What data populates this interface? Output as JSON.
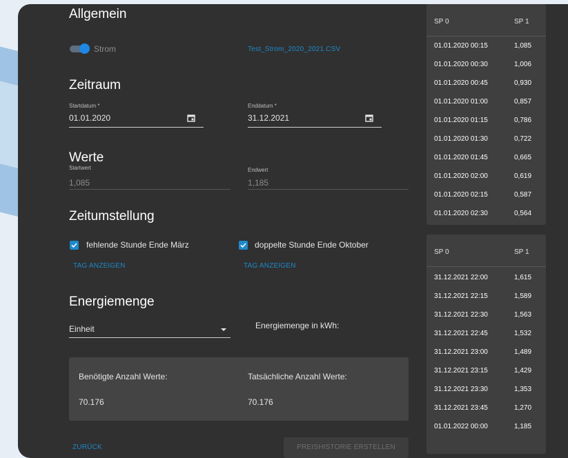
{
  "general": {
    "heading": "Allgemein",
    "toggle_label": "Strom",
    "file_name": "Test_Strom_2020_2021.CSV"
  },
  "period": {
    "heading": "Zeitraum",
    "start_label": "Startdatum *",
    "start_value": "01.01.2020",
    "end_label": "Enddatum *",
    "end_value": "31.12.2021"
  },
  "values": {
    "heading": "Werte",
    "start_label": "Startwert",
    "start_value": "1,085",
    "end_label": "Endwert",
    "end_value": "1,185"
  },
  "dst": {
    "heading": "Zeitumstellung",
    "missing_hour_label": "fehlende Stunde Ende März",
    "missing_hour_checked": true,
    "double_hour_label": "doppelte Stunde Ende Oktober",
    "double_hour_checked": true,
    "show_day_1": "TAG ANZEIGEN",
    "show_day_2": "TAG ANZEIGEN"
  },
  "energy": {
    "heading": "Energiemenge",
    "unit_select": "Einheit",
    "kwh_label": "Energiemenge in kWh:"
  },
  "summary": {
    "required_label": "Benötigte Anzahl Werte:",
    "required_value": "70.176",
    "actual_label": "Tatsächliche Anzahl Werte:",
    "actual_value": "70.176"
  },
  "actions": {
    "back": "ZURÜCK",
    "create": "PREISHISTORIE ERSTELLEN"
  },
  "table_top": {
    "col1": "SP 0",
    "col2": "SP 1",
    "rows": [
      [
        "01.01.2020 00:15",
        "1,085"
      ],
      [
        "01.01.2020 00:30",
        "1,006"
      ],
      [
        "01.01.2020 00:45",
        "0,930"
      ],
      [
        "01.01.2020 01:00",
        "0,857"
      ],
      [
        "01.01.2020 01:15",
        "0,786"
      ],
      [
        "01.01.2020 01:30",
        "0,722"
      ],
      [
        "01.01.2020 01:45",
        "0,665"
      ],
      [
        "01.01.2020 02:00",
        "0,619"
      ],
      [
        "01.01.2020 02:15",
        "0,587"
      ],
      [
        "01.01.2020 02:30",
        "0,564"
      ]
    ]
  },
  "table_bottom": {
    "col1": "SP 0",
    "col2": "SP 1",
    "rows": [
      [
        "31.12.2021 22:00",
        "1,615"
      ],
      [
        "31.12.2021 22:15",
        "1,589"
      ],
      [
        "31.12.2021 22:30",
        "1,563"
      ],
      [
        "31.12.2021 22:45",
        "1,532"
      ],
      [
        "31.12.2021 23:00",
        "1,489"
      ],
      [
        "31.12.2021 23:15",
        "1,429"
      ],
      [
        "31.12.2021 23:30",
        "1,353"
      ],
      [
        "31.12.2021 23:45",
        "1,270"
      ],
      [
        "01.01.2022 00:00",
        "1,185"
      ]
    ]
  },
  "colors": {
    "accent": "#1e88c9",
    "panel": "#303030",
    "table_bg": "#3f3f3f"
  }
}
